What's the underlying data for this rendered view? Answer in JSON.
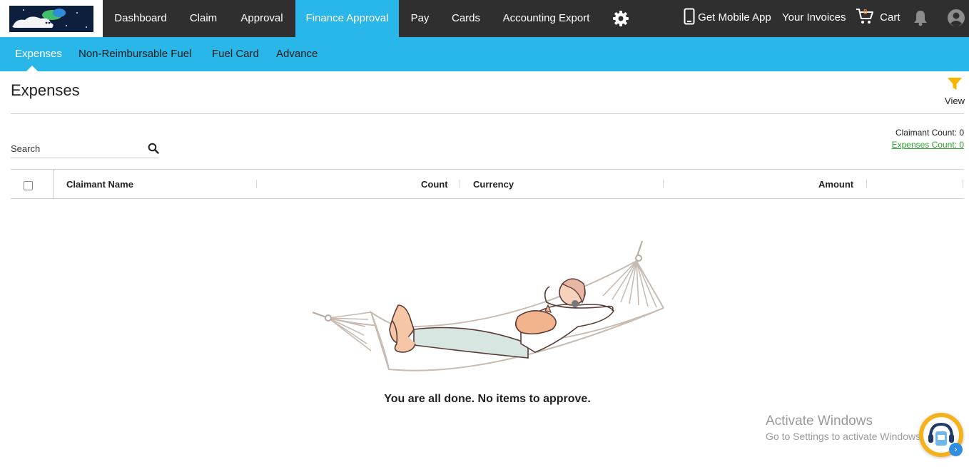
{
  "top_nav": {
    "items": [
      {
        "label": "Dashboard"
      },
      {
        "label": "Claim"
      },
      {
        "label": "Approval"
      },
      {
        "label": "Finance Approval",
        "active": true
      },
      {
        "label": "Pay"
      },
      {
        "label": "Cards"
      },
      {
        "label": "Accounting Export"
      }
    ],
    "settings_icon": "gear-icon",
    "mobile_app_label": "Get Mobile App",
    "invoices_label": "Your Invoices",
    "cart_count": "0",
    "cart_label": "Cart",
    "active_color": "#29b6e8"
  },
  "sub_nav": {
    "items": [
      {
        "label": "Expenses",
        "active": true
      },
      {
        "label": "Non-Reimbursable Fuel"
      },
      {
        "label": "Fuel Card"
      },
      {
        "label": "Advance"
      }
    ]
  },
  "page": {
    "title": "Expenses",
    "filter_label": "View",
    "claimant_count": "Claimant Count: 0",
    "expenses_count": "Expenses Count: 0"
  },
  "search": {
    "placeholder": "Search",
    "value": ""
  },
  "table": {
    "columns": [
      "Claimant Name",
      "Count",
      "Currency",
      "Amount"
    ],
    "rows": []
  },
  "empty_state": {
    "message": "You are all done. No items to approve."
  },
  "watermark": {
    "title": "Activate Windows",
    "subtitle": "Go to Settings to activate Windows."
  }
}
